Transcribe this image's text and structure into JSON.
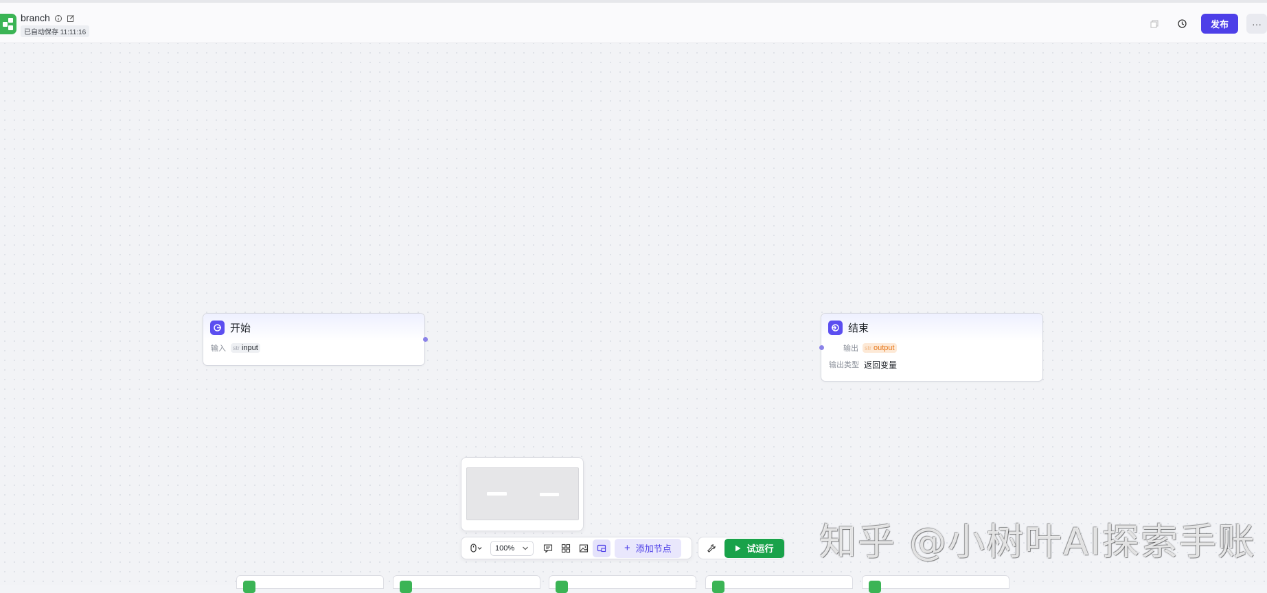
{
  "header": {
    "title": "branch",
    "autosave": "已自动保存 11:11:16",
    "publish_label": "发布",
    "more_label": "···",
    "icons": [
      "info-icon",
      "edit-icon",
      "copy-icon",
      "history-icon"
    ]
  },
  "nodes": {
    "start": {
      "name": "开始",
      "input_label": "输入",
      "var_type": "str",
      "var_name": "input"
    },
    "end": {
      "name": "结束",
      "output_label": "输出",
      "var_type": "str",
      "var_name": "output",
      "output_type_label": "输出类型",
      "output_type_value": "返回变量"
    }
  },
  "toolbar": {
    "zoom": "100%",
    "add_node_label": "添加节点",
    "run_label": "试运行"
  },
  "watermark": "知乎 @小树叶AI探索手账",
  "colors": {
    "accent": "#4d3fe8",
    "run": "#19a24a",
    "app_icon": "#3bb455",
    "output_tag": "#e6781c"
  }
}
